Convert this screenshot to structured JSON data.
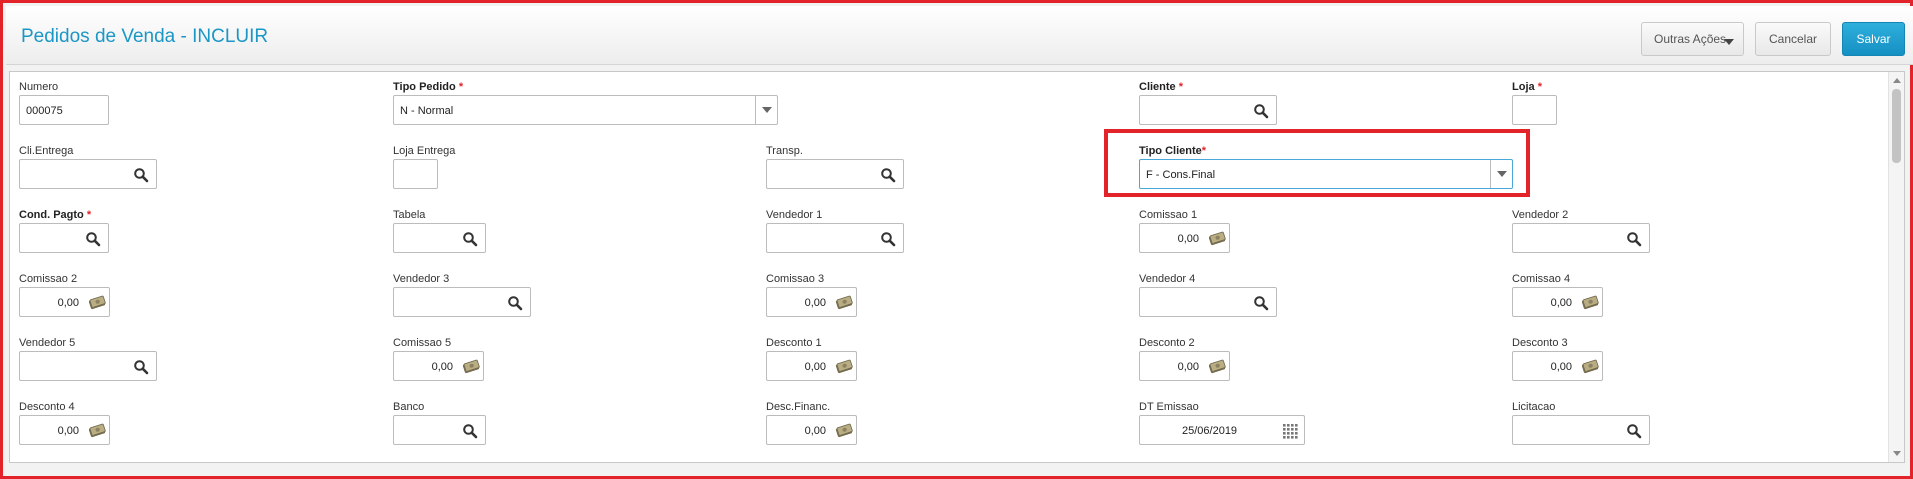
{
  "header": {
    "title": "Pedidos de Venda - INCLUIR",
    "outras_acoes": "Outras Ações",
    "cancelar": "Cancelar",
    "salvar": "Salvar"
  },
  "form": {
    "numero": {
      "label": "Numero",
      "value": "000075"
    },
    "tipo_pedido": {
      "label": "Tipo Pedido",
      "required": "*",
      "value": "N - Normal"
    },
    "cliente": {
      "label": "Cliente",
      "required": "*"
    },
    "loja": {
      "label": "Loja",
      "required": "*"
    },
    "cli_entrega": {
      "label": "Cli.Entrega"
    },
    "loja_entrega": {
      "label": "Loja Entrega"
    },
    "transp": {
      "label": "Transp."
    },
    "tipo_cliente": {
      "label": "Tipo Cliente",
      "required": "*",
      "value": "F - Cons.Final"
    },
    "cond_pagto": {
      "label": "Cond. Pagto",
      "required": "*"
    },
    "tabela": {
      "label": "Tabela"
    },
    "vendedor1": {
      "label": "Vendedor 1"
    },
    "comissao1": {
      "label": "Comissao 1",
      "value": "0,00"
    },
    "vendedor2": {
      "label": "Vendedor 2"
    },
    "comissao2": {
      "label": "Comissao 2",
      "value": "0,00"
    },
    "vendedor3": {
      "label": "Vendedor 3"
    },
    "comissao3": {
      "label": "Comissao 3",
      "value": "0,00"
    },
    "vendedor4": {
      "label": "Vendedor 4"
    },
    "comissao4": {
      "label": "Comissao 4",
      "value": "0,00"
    },
    "vendedor5": {
      "label": "Vendedor 5"
    },
    "comissao5": {
      "label": "Comissao 5",
      "value": "0,00"
    },
    "desconto1": {
      "label": "Desconto 1",
      "value": "0,00"
    },
    "desconto2": {
      "label": "Desconto 2",
      "value": "0,00"
    },
    "desconto3": {
      "label": "Desconto 3",
      "value": "0,00"
    },
    "desconto4": {
      "label": "Desconto 4",
      "value": "0,00"
    },
    "banco": {
      "label": "Banco"
    },
    "desc_financ": {
      "label": "Desc.Financ.",
      "value": "0,00"
    },
    "dt_emissao": {
      "label": "DT Emissao",
      "value": "25/06/2019"
    },
    "licitacao": {
      "label": "Licitacao"
    }
  },
  "colors": {
    "accent": "#1b97c6",
    "highlight": "#e2232a",
    "primary_button": "#1590c3"
  },
  "icons": {
    "lookup": "search-icon",
    "money": "money-icon",
    "calendar": "calendar-icon",
    "dropdown": "chevron-down-icon"
  }
}
